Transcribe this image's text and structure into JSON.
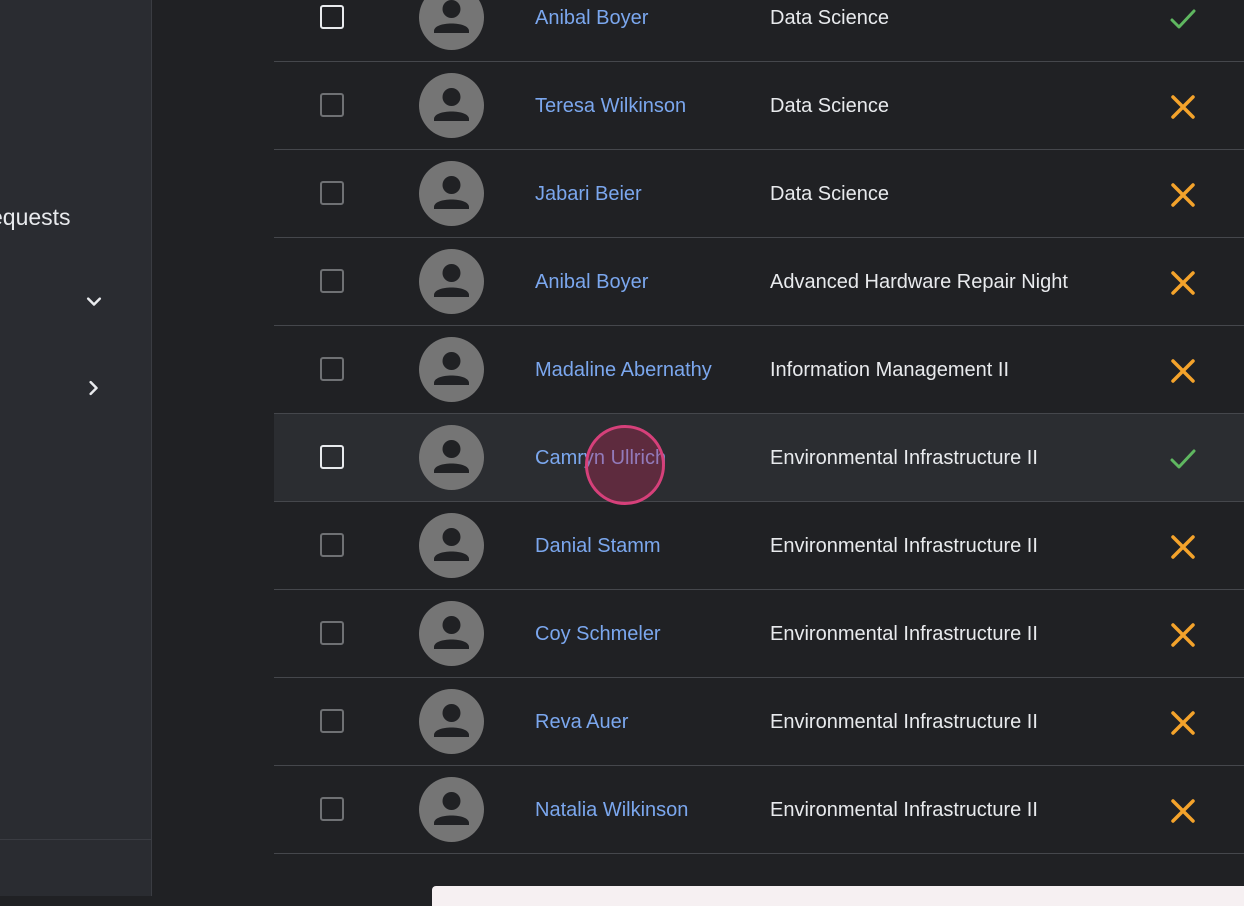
{
  "sidebar": {
    "items": [
      {
        "label": "equests",
        "icon": "none"
      },
      {
        "label": "",
        "icon": "chevron-down-icon"
      },
      {
        "label": "",
        "icon": "chevron-right-icon"
      }
    ]
  },
  "table": {
    "rows": [
      {
        "name": "Anibal Boyer",
        "department": "Data Science",
        "status": "approved"
      },
      {
        "name": "Teresa Wilkinson",
        "department": "Data Science",
        "status": "rejected"
      },
      {
        "name": "Jabari Beier",
        "department": "Data Science",
        "status": "rejected"
      },
      {
        "name": "Anibal Boyer",
        "department": "Advanced Hardware Repair Night",
        "status": "rejected"
      },
      {
        "name": "Madaline Abernathy",
        "department": "Information Management II",
        "status": "rejected"
      },
      {
        "name": "Camryn Ullrich",
        "department": "Environmental Infrastructure II",
        "status": "approved"
      },
      {
        "name": "Danial Stamm",
        "department": "Environmental Infrastructure II",
        "status": "rejected"
      },
      {
        "name": "Coy Schmeler",
        "department": "Environmental Infrastructure II",
        "status": "rejected"
      },
      {
        "name": "Reva Auer",
        "department": "Environmental Infrastructure II",
        "status": "rejected"
      },
      {
        "name": "Natalia Wilkinson",
        "department": "Environmental Infrastructure II",
        "status": "rejected"
      }
    ]
  },
  "colors": {
    "background": "#202124",
    "sidebar": "#2a2c31",
    "link": "#7ba7ee",
    "approved": "#5fb760",
    "rejected": "#f4a32b",
    "avatar": "#757575",
    "click_indicator": "#d6407a"
  }
}
